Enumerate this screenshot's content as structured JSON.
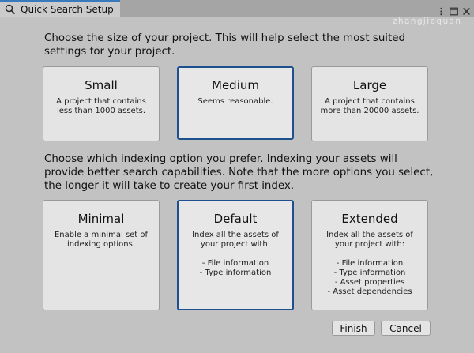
{
  "window": {
    "tab_title": "Quick Search Setup",
    "watermark": "zhangjiequan"
  },
  "size_section": {
    "prompt": "Choose the size of your project. This will help select the most suited settings for your project.",
    "options": [
      {
        "title": "Small",
        "desc": "A project that contains less than 1000 assets.",
        "selected": false
      },
      {
        "title": "Medium",
        "desc": "Seems reasonable.",
        "selected": true
      },
      {
        "title": "Large",
        "desc": "A project that contains more than 20000 assets.",
        "selected": false
      }
    ]
  },
  "index_section": {
    "prompt": "Choose which indexing option you prefer. Indexing your assets will provide better search capabilities. Note that the more options you select, the longer it will take to create your first index.",
    "options": [
      {
        "title": "Minimal",
        "desc": "Enable a minimal set of indexing options.",
        "selected": false
      },
      {
        "title": "Default",
        "desc": "Index all the assets of your project with:\n\n- File information\n- Type information",
        "selected": true
      },
      {
        "title": "Extended",
        "desc": "Index all the assets of your project with:\n\n- File information\n- Type information\n- Asset properties\n- Asset dependencies",
        "selected": false
      }
    ]
  },
  "buttons": {
    "finish": "Finish",
    "cancel": "Cancel"
  },
  "colors": {
    "background": "#c2c2c2",
    "card": "#e4e4e4",
    "selected_border": "#1e4f8e",
    "tab_accent": "#3a79bb"
  }
}
